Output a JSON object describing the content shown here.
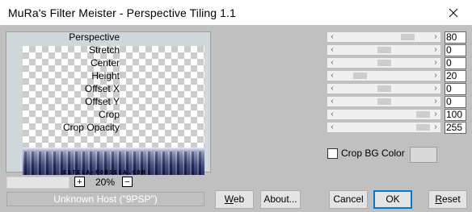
{
  "window": {
    "title": "MuRa's Filter Meister - Perspective Tiling 1.1",
    "close_glyph": "✕"
  },
  "preview": {
    "watermark": "ESTELA·FONSECA.COM",
    "zoom_value": "20%",
    "zoom_plus": "+",
    "zoom_minus": "−",
    "status_text": "Unknown Host (\"9PSP\")"
  },
  "params": [
    {
      "label": "Perspective",
      "value": "80",
      "level": 0.8
    },
    {
      "label": "Stretch",
      "value": "0",
      "level": 0.5
    },
    {
      "label": "Center",
      "value": "0",
      "level": 0.5
    },
    {
      "label": "Height",
      "value": "20",
      "level": 0.2
    },
    {
      "label": "Offset X",
      "value": "0",
      "level": 0.5
    },
    {
      "label": "Offset Y",
      "value": "0",
      "level": 0.5
    },
    {
      "label": "Crop",
      "value": "100",
      "level": 1.0
    },
    {
      "label": "Crop Opacity",
      "value": "255",
      "level": 1.0
    }
  ],
  "slider_arrows": {
    "left": "‹",
    "right": "›"
  },
  "crop_bg": {
    "label": "Crop BG Color",
    "checked": false,
    "swatch_color": "#d8d8d8"
  },
  "buttons": {
    "web": {
      "mnemonic": "W",
      "rest": "eb"
    },
    "about": {
      "label": "About..."
    },
    "cancel": {
      "label": "Cancel"
    },
    "ok": {
      "label": "OK"
    },
    "reset": {
      "mnemonic": "R",
      "rest": "eset"
    }
  },
  "colors": {
    "dialog_bg": "#c0c0c0",
    "ok_focus_border": "#0078d7",
    "slider_track": "#f0f0f0",
    "slider_thumb": "#cdcdcd"
  }
}
